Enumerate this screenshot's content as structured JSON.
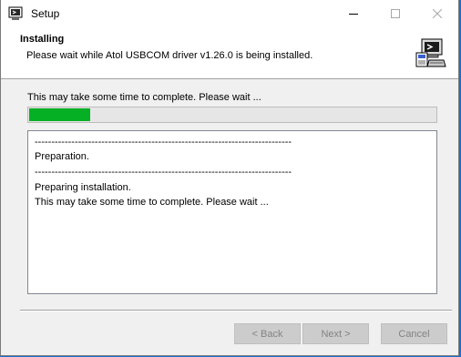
{
  "window": {
    "title": "Setup",
    "icon": "setup-app-icon"
  },
  "controls": {
    "minimize_icon": "minimize-icon",
    "maximize_icon": "maximize-icon",
    "close_icon": "close-icon"
  },
  "header": {
    "title": "Installing",
    "subtitle": "Please wait while Atol USBCOM driver v1.26.0 is being installed.",
    "icon": "installer-computer-icon"
  },
  "progress": {
    "status_text": "This may take some time to complete. Please wait ...",
    "fraction": 0.15,
    "color": "#06b025"
  },
  "log": {
    "lines": [
      "-----------------------------------------------------------------------------",
      "Preparation.",
      "-----------------------------------------------------------------------------",
      "Preparing installation.",
      "This may take some time to complete. Please wait ..."
    ]
  },
  "buttons": {
    "back": "< Back",
    "next": "Next >",
    "cancel": "Cancel"
  }
}
